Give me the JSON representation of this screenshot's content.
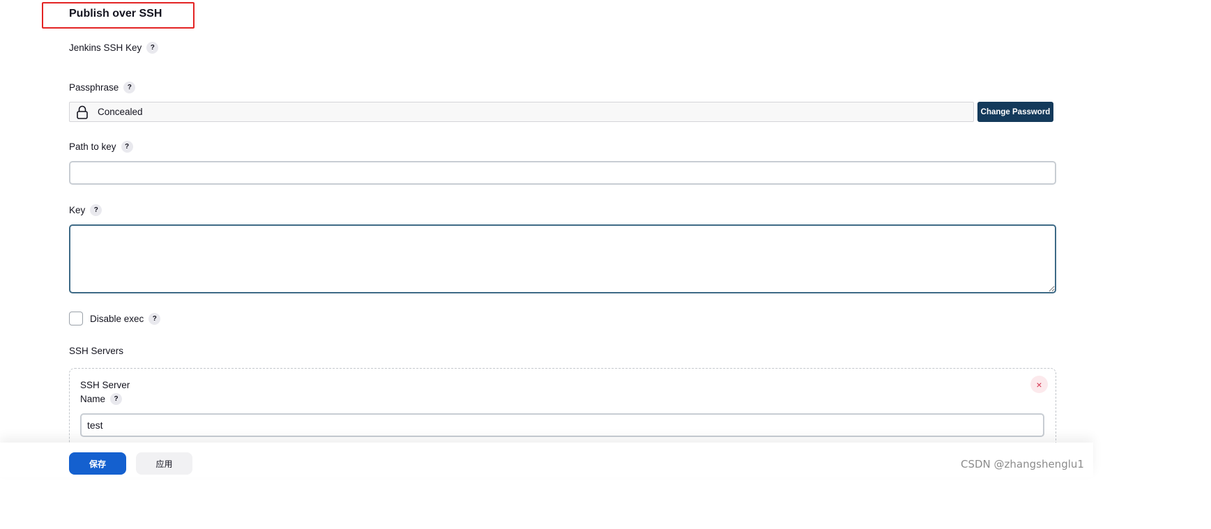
{
  "section": {
    "title": "Publish over SSH"
  },
  "fields": {
    "jenkins_ssh_key": {
      "label": "Jenkins SSH Key",
      "help": "?"
    },
    "passphrase": {
      "label": "Passphrase",
      "help": "?",
      "value": "Concealed",
      "change_button": "Change Password"
    },
    "path_to_key": {
      "label": "Path to key",
      "help": "?",
      "value": ""
    },
    "key": {
      "label": "Key",
      "help": "?",
      "value": ""
    },
    "disable_exec": {
      "label": "Disable exec",
      "help": "?",
      "checked": false
    }
  },
  "ssh_servers": {
    "label": "SSH Servers",
    "server": {
      "heading": "SSH Server",
      "name_label": "Name",
      "help": "?",
      "name_value": "test",
      "remove": "×"
    }
  },
  "footer": {
    "save": "保存",
    "apply": "应用"
  },
  "watermark": "CSDN @zhangshenglu1",
  "colors": {
    "primary": "#1460cf",
    "dark_button": "#143a5b",
    "highlight": "#e32424",
    "danger": "#d32f4a"
  }
}
